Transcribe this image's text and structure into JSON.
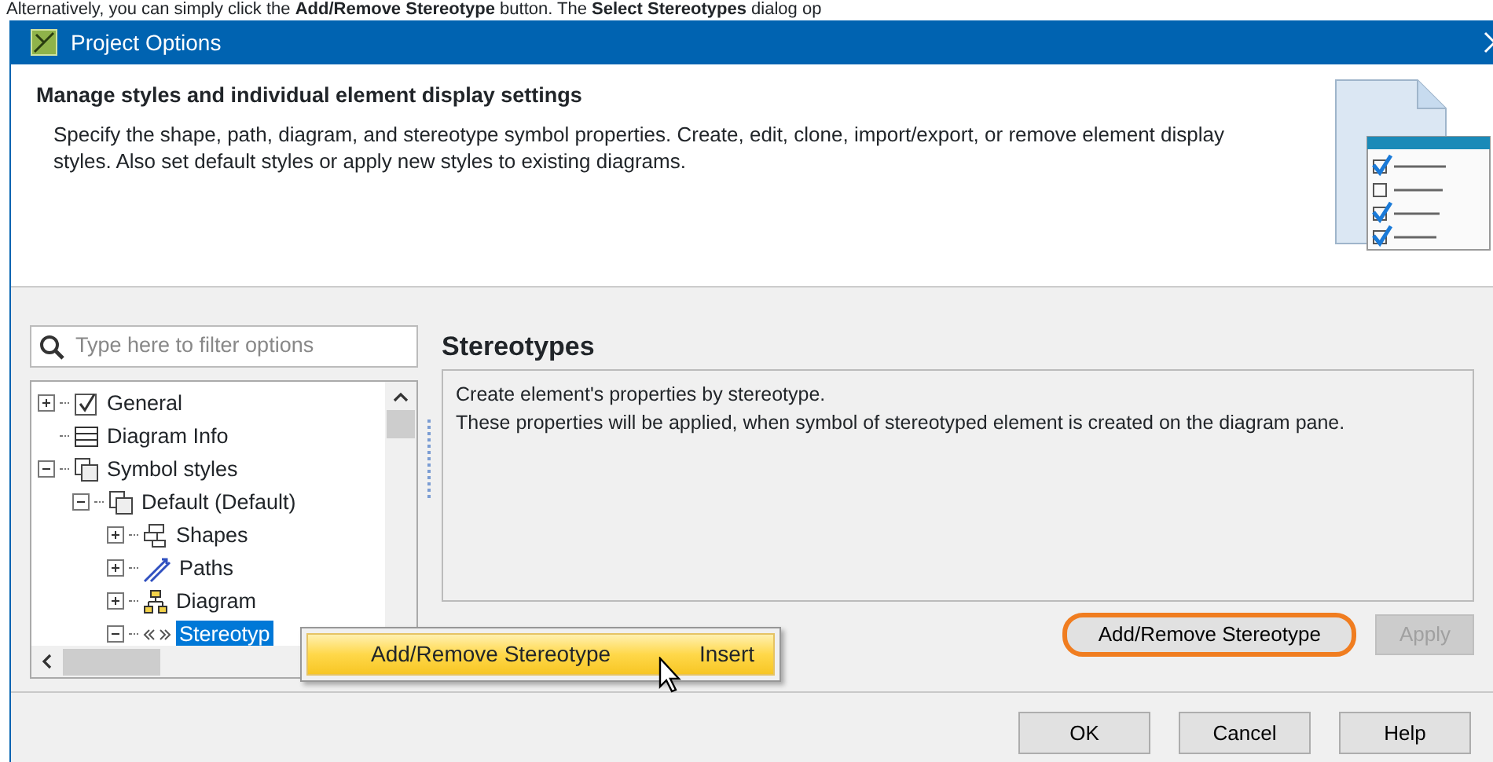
{
  "caption": "Alternatively, you can simply click the **Add/Remove Stereotype** button. The **Select Stereotypes** dialog op",
  "window": {
    "title": "Project Options"
  },
  "header": {
    "title": "Manage styles and individual element display settings",
    "description": "Specify the shape, path, diagram, and stereotype symbol properties. Create, edit, clone, import/export, or remove element display styles. Also set default styles or apply new styles to existing diagrams."
  },
  "filter": {
    "placeholder": "Type here to filter options"
  },
  "tree": [
    {
      "label": "General",
      "kind": "check",
      "expanded": false,
      "selected": false
    },
    {
      "label": "Diagram Info",
      "kind": "list",
      "selected": false
    },
    {
      "label": "Symbol styles",
      "kind": "styles",
      "expanded": true,
      "selected": false,
      "children": [
        {
          "label": "Default (Default)",
          "kind": "styles",
          "expanded": true,
          "selected": false,
          "children": [
            {
              "label": "Shapes",
              "kind": "shapes",
              "expanded": false,
              "selected": false
            },
            {
              "label": "Paths",
              "kind": "paths",
              "expanded": false,
              "selected": false
            },
            {
              "label": "Diagram",
              "kind": "diagram",
              "expanded": false,
              "selected": false
            },
            {
              "label": "Stereotyp",
              "kind": "stereotype",
              "expanded": true,
              "selected": true
            }
          ]
        }
      ]
    }
  ],
  "panel": {
    "title": "Stereotypes",
    "lines": [
      "Create element's properties by stereotype.",
      "These properties will be applied, when symbol of stereotyped element is created on the diagram pane."
    ]
  },
  "panel_buttons": [
    {
      "label": "Add/Remove Stereotype",
      "highlighted": true,
      "disabled": false
    },
    {
      "label": "Apply",
      "highlighted": false,
      "disabled": true
    }
  ],
  "context_menu": {
    "items": [
      {
        "label": "Add/Remove Stereotype",
        "shortcut": "Insert",
        "selected": true
      }
    ]
  },
  "dialog_buttons": [
    "OK",
    "Cancel",
    "Help"
  ]
}
